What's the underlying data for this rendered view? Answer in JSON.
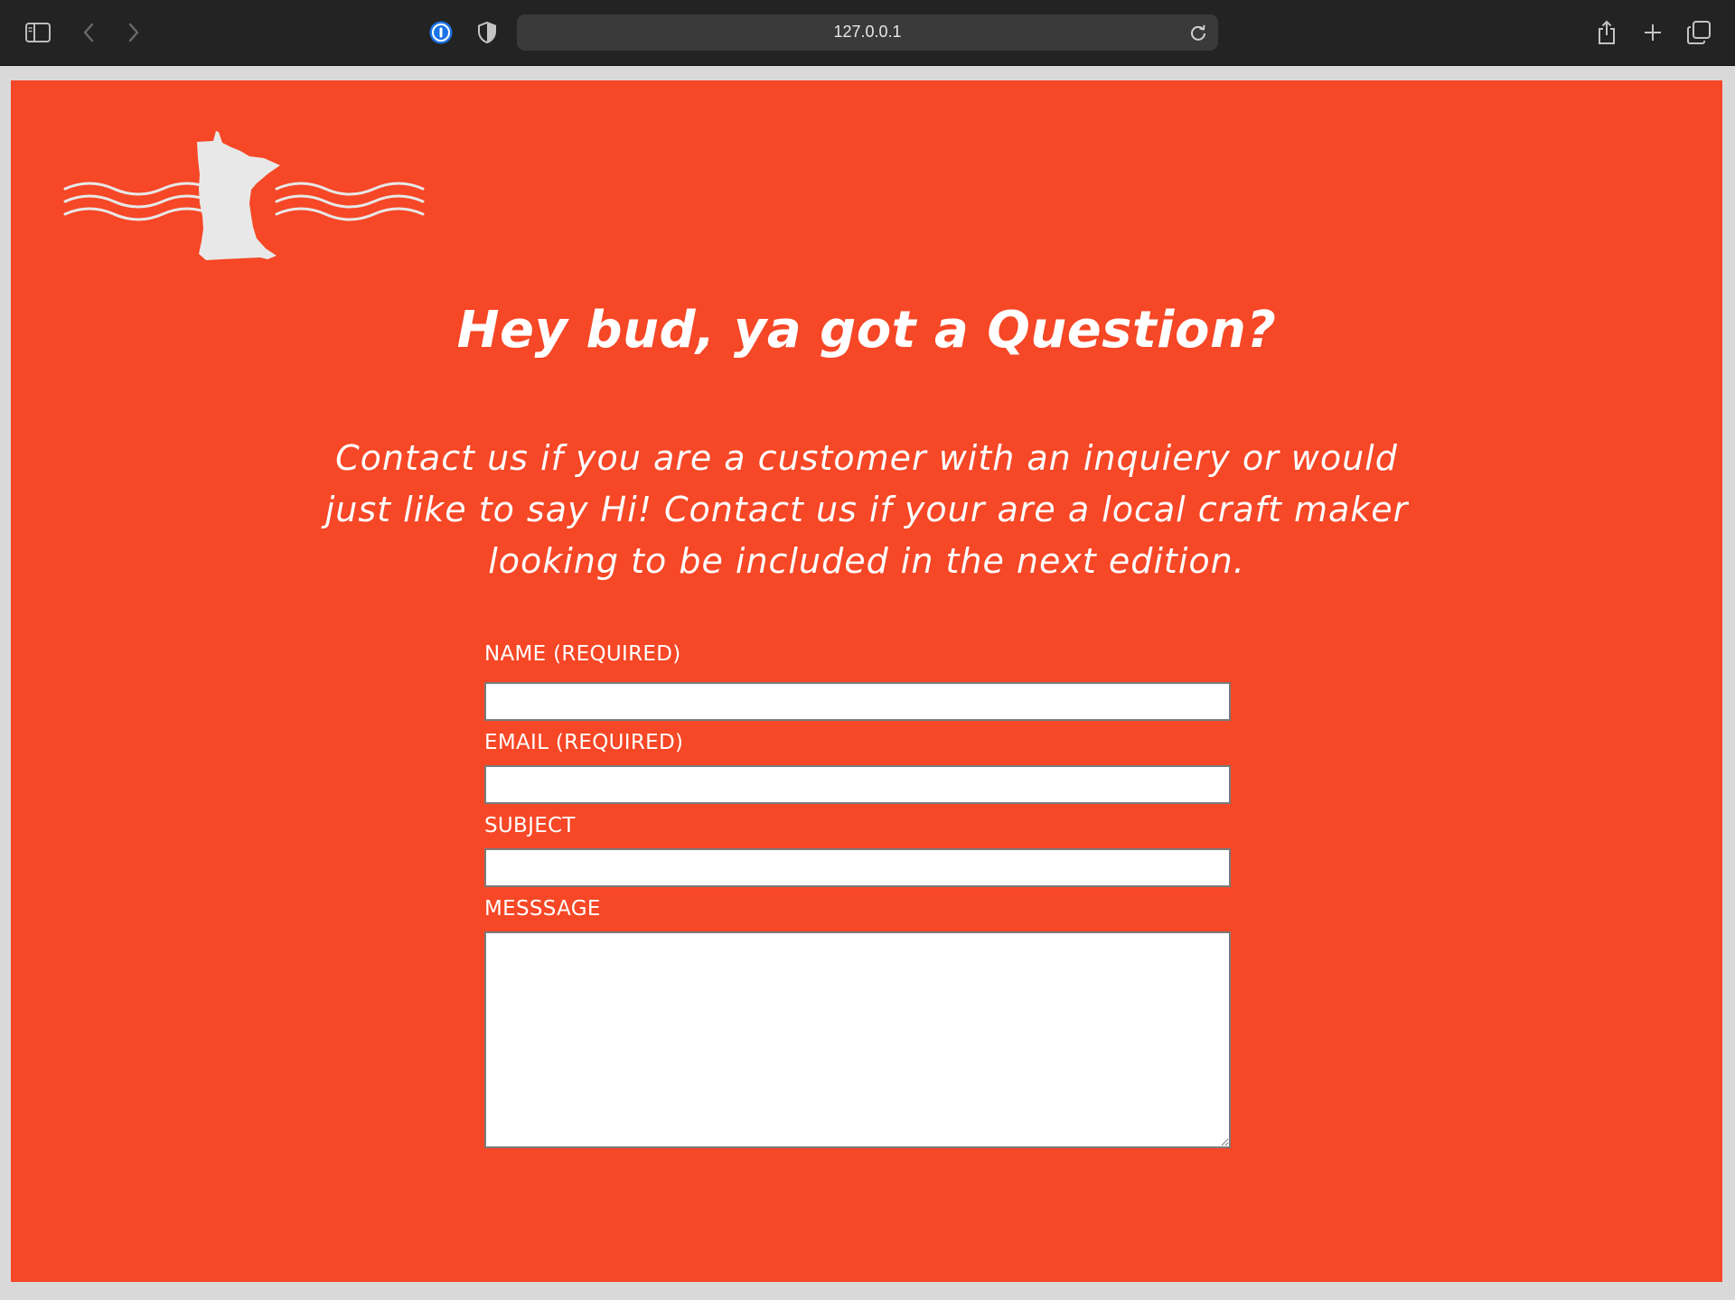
{
  "browser": {
    "url": "127.0.0.1",
    "icons": [
      "sidebar-icon",
      "back-icon",
      "forward-icon",
      "password-manager-icon",
      "shield-icon",
      "reload-icon",
      "share-icon",
      "new-tab-icon",
      "tabs-overview-icon"
    ]
  },
  "page": {
    "background_color": "#f64726",
    "logo": {
      "icon": "minnesota-map-logo",
      "color": "#e8e8e8"
    },
    "heading": "Hey bud, ya got a Question?",
    "intro": "Contact us if you are a customer with an inquiery or would just like to say Hi! Contact us if your are a local craft maker looking to be included in the next edition.",
    "form": {
      "name_label": "NAME (REQUIRED)",
      "name_value": "",
      "email_label": "EMAIL (REQUIRED)",
      "email_value": "",
      "subject_label": "SUBJECT",
      "subject_value": "",
      "message_label": "MESSSAGE",
      "message_value": ""
    }
  }
}
